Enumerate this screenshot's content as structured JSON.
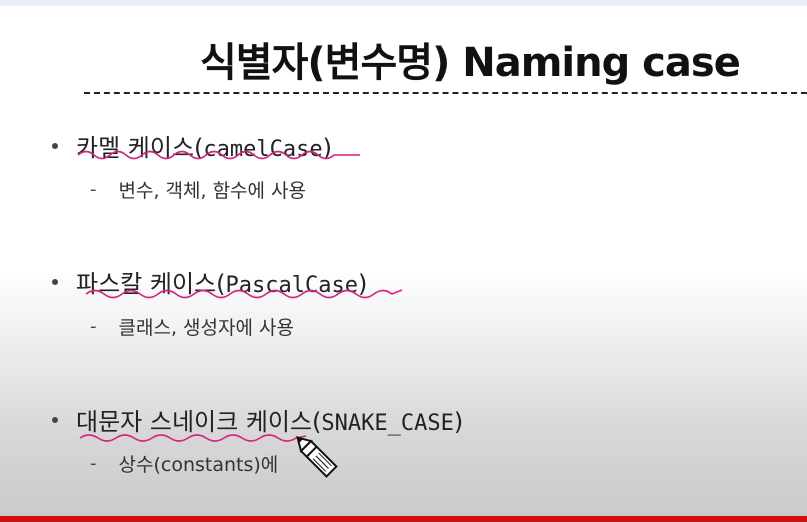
{
  "slide": {
    "title": "식별자(변수명) Naming case",
    "items": [
      {
        "label_ko": "카멜 케이스(",
        "label_code": "camelCase",
        "label_end": ")",
        "sub": "변수, 객체, 함수에 사용"
      },
      {
        "label_ko": "파스칼 케이스(",
        "label_code": "PascalCase",
        "label_end": ")",
        "sub": "클래스, 생성자에 사용"
      },
      {
        "label_ko": "대문자 스네이크 케이스(",
        "label_code": "SNAKE_CASE",
        "label_end": ")",
        "sub": "상수(constants)에"
      }
    ]
  },
  "annotations": {
    "underline_color": "#d6247a",
    "cursor_icon": "pencil-cursor-icon"
  }
}
